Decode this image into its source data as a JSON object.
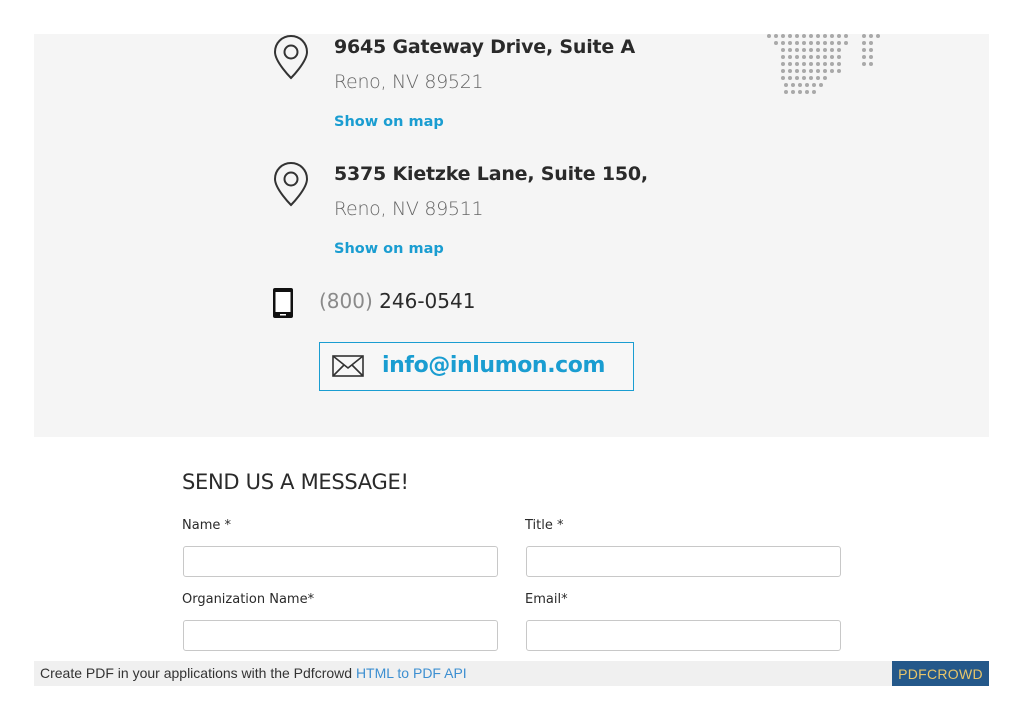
{
  "locations": [
    {
      "line1": "9645 Gateway Drive, Suite A",
      "line2": "Reno, NV 89521",
      "map_link": "Show on map"
    },
    {
      "line1": "5375 Kietzke Lane, Suite 150,",
      "line2": "Reno, NV 89511",
      "map_link": "Show on map"
    }
  ],
  "phone": {
    "area": "(800)",
    "number": "246-0541"
  },
  "email": {
    "address": "info@inlumon.com"
  },
  "form": {
    "title": "SEND US A MESSAGE!",
    "name_label": "Name *",
    "title_label": "Title *",
    "org_label": "Organization Name*",
    "email_label": "Email*",
    "name_value": "",
    "title_value": "",
    "org_value": "",
    "email_value": ""
  },
  "footer": {
    "prefix": "Create PDF in your applications with the Pdfcrowd ",
    "link": "HTML to PDF API",
    "badge": "PDFCROWD"
  },
  "icons": {
    "location": "map-pin-icon",
    "phone": "mobile-phone-icon",
    "mail": "envelope-icon"
  },
  "colors": {
    "accent": "#1a9dd1",
    "panel_bg": "#f5f5f5",
    "badge_bg": "#24588a",
    "badge_text": "#e8c66a"
  }
}
